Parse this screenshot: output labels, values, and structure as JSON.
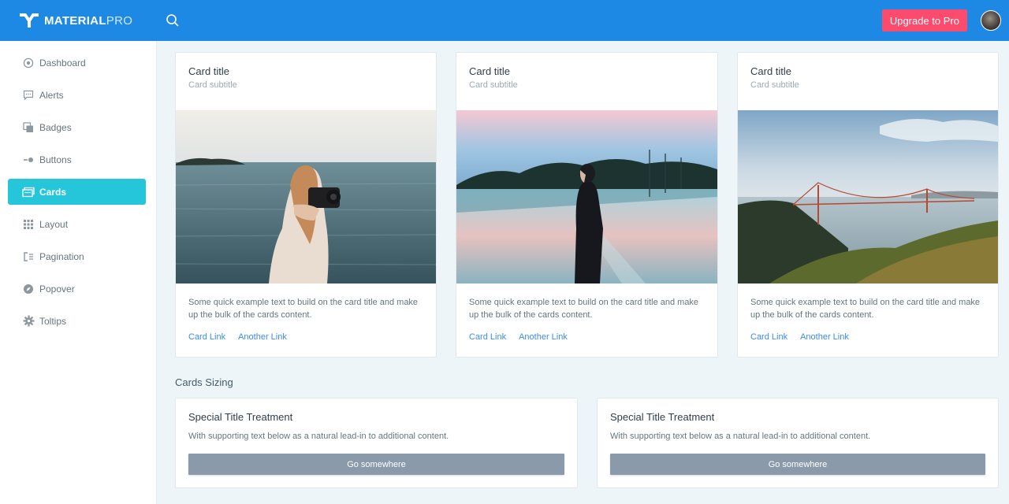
{
  "brand": {
    "bold": "MATERIAL",
    "light": "PRO"
  },
  "topbar": {
    "upgrade_label": "Upgrade to Pro"
  },
  "sidebar": {
    "items": [
      {
        "label": "Dashboard",
        "icon": "circle-dot-icon"
      },
      {
        "label": "Alerts",
        "icon": "message-icon"
      },
      {
        "label": "Badges",
        "icon": "layers-icon"
      },
      {
        "label": "Buttons",
        "icon": "toggle-icon"
      },
      {
        "label": "Cards",
        "icon": "cards-icon",
        "active": true
      },
      {
        "label": "Layout",
        "icon": "grid-icon"
      },
      {
        "label": "Pagination",
        "icon": "pagination-icon"
      },
      {
        "label": "Popover",
        "icon": "compass-icon"
      },
      {
        "label": "Toltips",
        "icon": "gear-icon"
      }
    ]
  },
  "cards": [
    {
      "title": "Card title",
      "subtitle": "Card subtitle",
      "image": "woman photographing sea with camera",
      "text": "Some quick example text to build on the card title and make up the bulk of the cards content.",
      "link1": "Card Link",
      "link2": "Another Link"
    },
    {
      "title": "Card title",
      "subtitle": "Card subtitle",
      "image": "person in hoodie on wet bridge at sunset",
      "text": "Some quick example text to build on the card title and make up the bulk of the cards content.",
      "link1": "Card Link",
      "link2": "Another Link"
    },
    {
      "title": "Card title",
      "subtitle": "Card subtitle",
      "image": "golden gate bridge from hills",
      "text": "Some quick example text to build on the card title and make up the bulk of the cards content.",
      "link1": "Card Link",
      "link2": "Another Link"
    }
  ],
  "sizing": {
    "heading": "Cards Sizing",
    "cards": [
      {
        "title": "Special Title Treatment",
        "text": "With supporting text below as a natural lead-in to additional content.",
        "button": "Go somewhere"
      },
      {
        "title": "Special Title Treatment",
        "text": "With supporting text below as a natural lead-in to additional content.",
        "button": "Go somewhere"
      }
    ]
  },
  "colors": {
    "topbar": "#1e88e5",
    "active": "#26c6da",
    "upgrade": "#fc4b6c",
    "link": "#398bf7",
    "button": "#8a9aab"
  }
}
